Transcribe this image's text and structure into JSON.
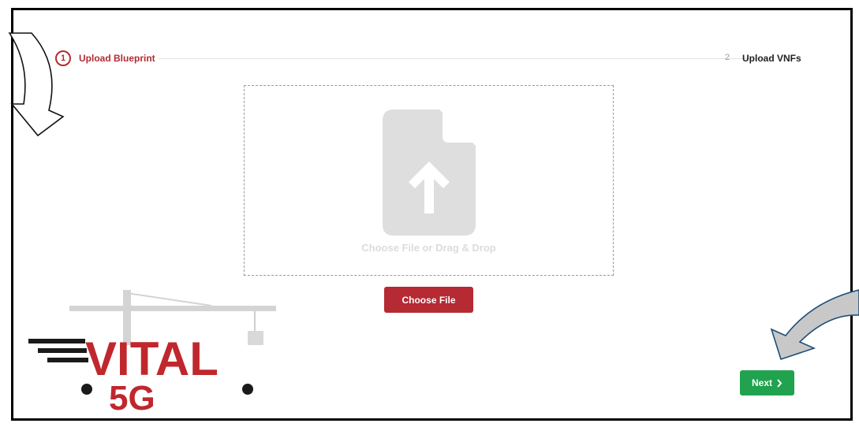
{
  "stepper": {
    "step1": {
      "number": "1",
      "label": "Upload Blueprint"
    },
    "step2": {
      "number": "2",
      "label": "Upload VNFs"
    }
  },
  "upload": {
    "drop_text": "Choose File or Drag & Drop",
    "choose_label": "Choose File"
  },
  "navigation": {
    "next_label": "Next",
    "next_icon": "chevron-right-icon"
  },
  "logo": {
    "word": "VITAL",
    "sub": "5G"
  },
  "colors": {
    "accent": "#b52a33",
    "success": "#20a24f",
    "icon_gray": "#dedede"
  }
}
